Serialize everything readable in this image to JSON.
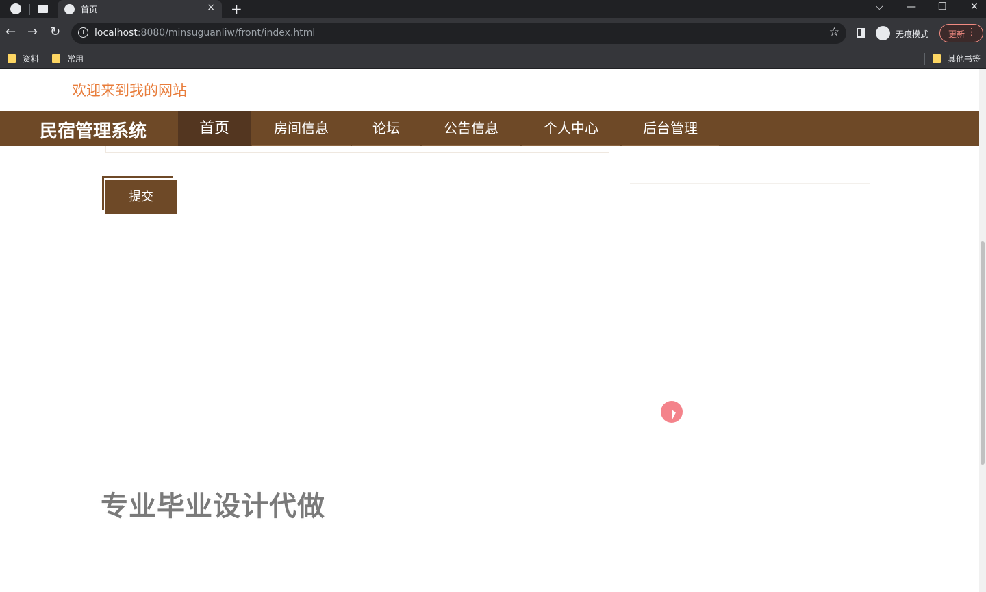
{
  "browser": {
    "tab_title": "首页",
    "tab_close": "×",
    "new_tab": "+",
    "url_host": "localhost",
    "url_rest": ":8080/minsuguanliw/front/index.html",
    "incognito_label": "无痕模式",
    "update_label": "更新",
    "window_controls": {
      "dropdown": "⌵",
      "minimize": "—",
      "restore": "❐",
      "close": "✕"
    },
    "bookmarks": [
      {
        "label": "资料"
      },
      {
        "label": "常用"
      }
    ],
    "other_bookmarks": "其他书签"
  },
  "page": {
    "welcome": "欢迎来到我的网站",
    "brand": "民宿管理系统",
    "nav": [
      {
        "label": "首页",
        "active": true
      },
      {
        "label": "房间信息",
        "active": false
      },
      {
        "label": "论坛",
        "active": false
      },
      {
        "label": "公告信息",
        "active": false
      },
      {
        "label": "个人中心",
        "active": false
      },
      {
        "label": "后台管理",
        "active": false
      }
    ],
    "submit_label": "提交",
    "watermark": "专业毕业设计代做"
  },
  "colors": {
    "nav_background": "#6e4927",
    "nav_active": "#533620",
    "welcome_text": "#e87c3a"
  }
}
